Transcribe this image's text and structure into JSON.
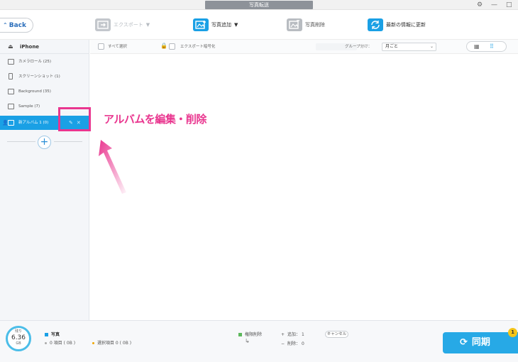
{
  "window": {
    "title": "写真転送"
  },
  "toolbar": {
    "back_label": "Back",
    "export_label": "エクスポート",
    "add_photo_label": "写真追加",
    "delete_photo_label": "写真削除",
    "refresh_label": "最新の情報に更新"
  },
  "sidebar": {
    "device": "iPhone",
    "albums": [
      {
        "label": "カメラロール (25)",
        "icon": "camera-icon"
      },
      {
        "label": "スクリーンショット (1)",
        "icon": "phone-icon"
      },
      {
        "label": "Background (35)",
        "icon": "image-icon"
      },
      {
        "label": "Sample (7)",
        "icon": "image-icon"
      },
      {
        "label": "新アルバム 1 (0)",
        "icon": "image-icon",
        "selected": true
      }
    ]
  },
  "main": {
    "select_all_label": "すべて選択",
    "export_encrypt_label": "エクスポート暗号化",
    "group_label": "グループ分け：",
    "group_value": "月ごと"
  },
  "annotation": {
    "callout": "アルバムを編集・削除",
    "color": "#e9368f"
  },
  "footer": {
    "storage_label": "残り",
    "storage_value": "6.36",
    "storage_unit": "GB",
    "category_label": "写真",
    "items_text": "0 項目 ( 0B )",
    "selected_text": "選択項目 0 ( 0B )",
    "permission_label": "権限削除",
    "add_text": "追加： 1",
    "delete_text": "削除： 0",
    "cancel_label": "キャンセル",
    "sync_label": "同期",
    "badge_count": "1"
  },
  "colors": {
    "accent": "#1aa0e5",
    "sync": "#27a9e6",
    "highlight": "#e9368f",
    "badge": "#f5c518"
  }
}
